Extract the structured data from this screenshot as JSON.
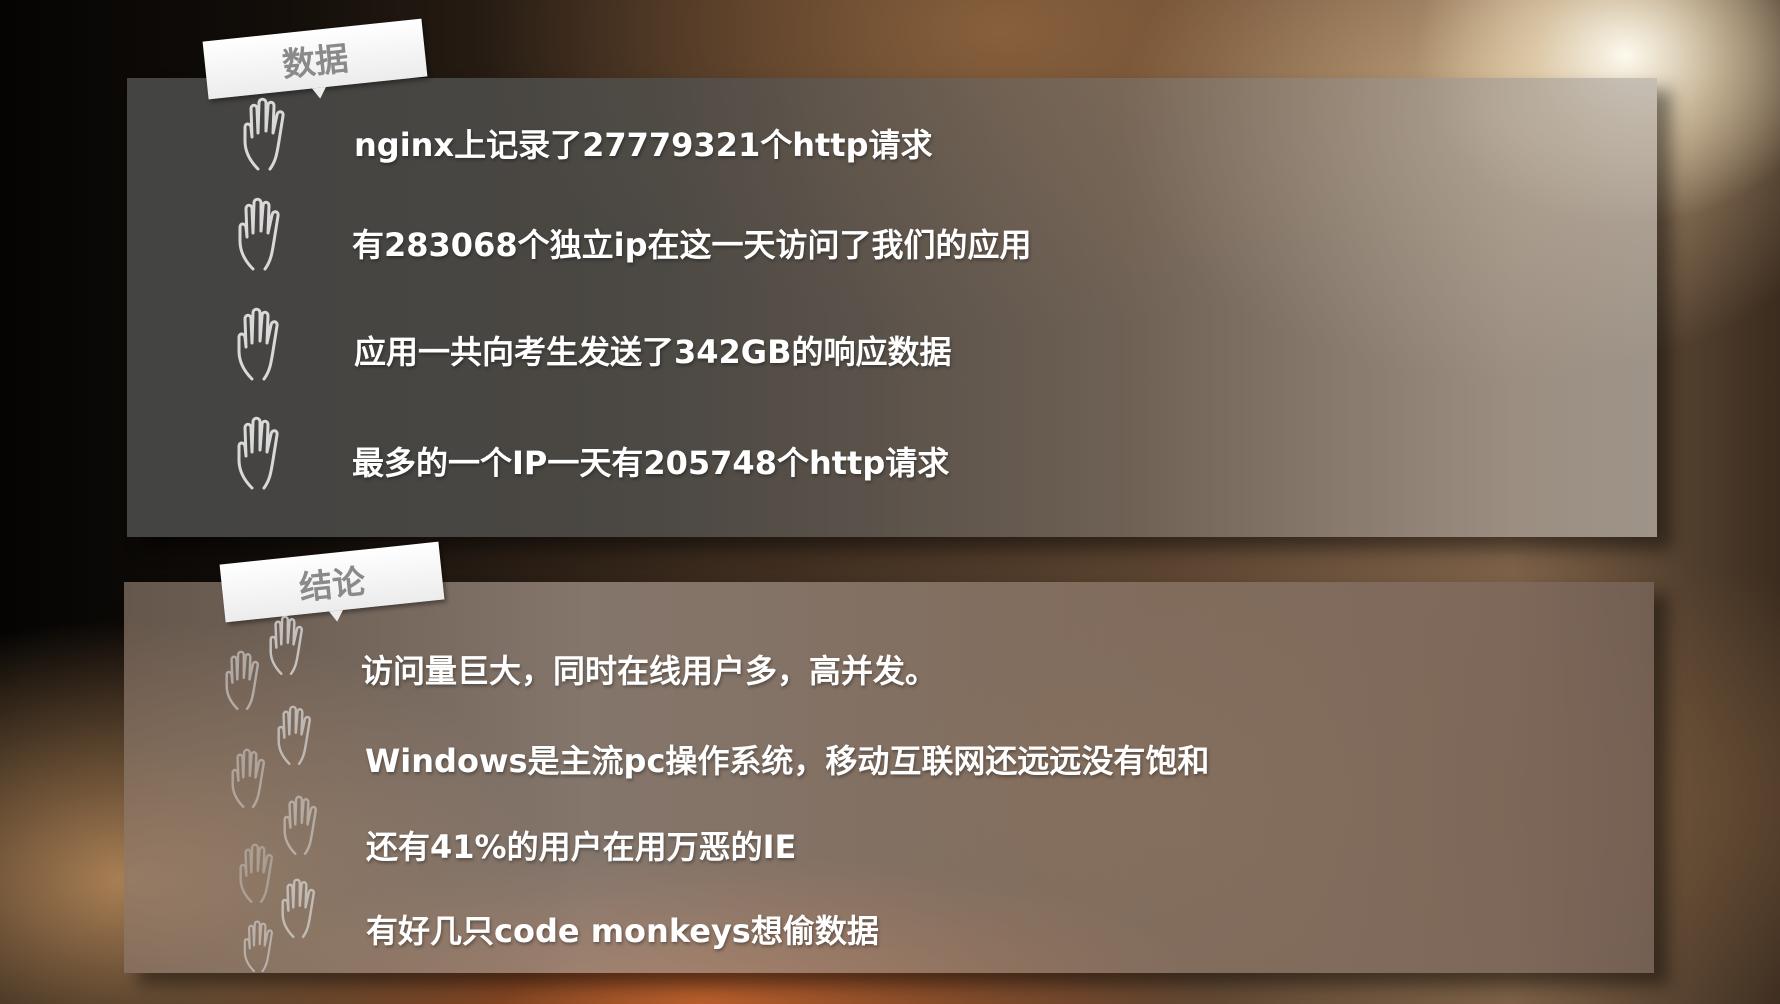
{
  "data_section": {
    "tag": "数据",
    "items": [
      "nginx上记录了27779321个http请求",
      "有283068个独立ip在这一天访问了我们的应用",
      "应用一共向考生发送了342GB的响应数据",
      "最多的一个IP一天有205748个http请求"
    ]
  },
  "conclusion_section": {
    "tag": "结论",
    "items": [
      "访问量巨大，同时在线用户多，高并发。",
      "Windows是主流pc操作系统，移动互联网还远远没有饱和",
      "还有41%的用户在用万恶的IE",
      "有好几只code monkeys想偷数据"
    ]
  },
  "icons": {
    "bullet": "hand-icon"
  },
  "colors": {
    "text": "#ffffff",
    "tag_text": "#8a8a8a",
    "tag_bg": "#ffffff"
  }
}
